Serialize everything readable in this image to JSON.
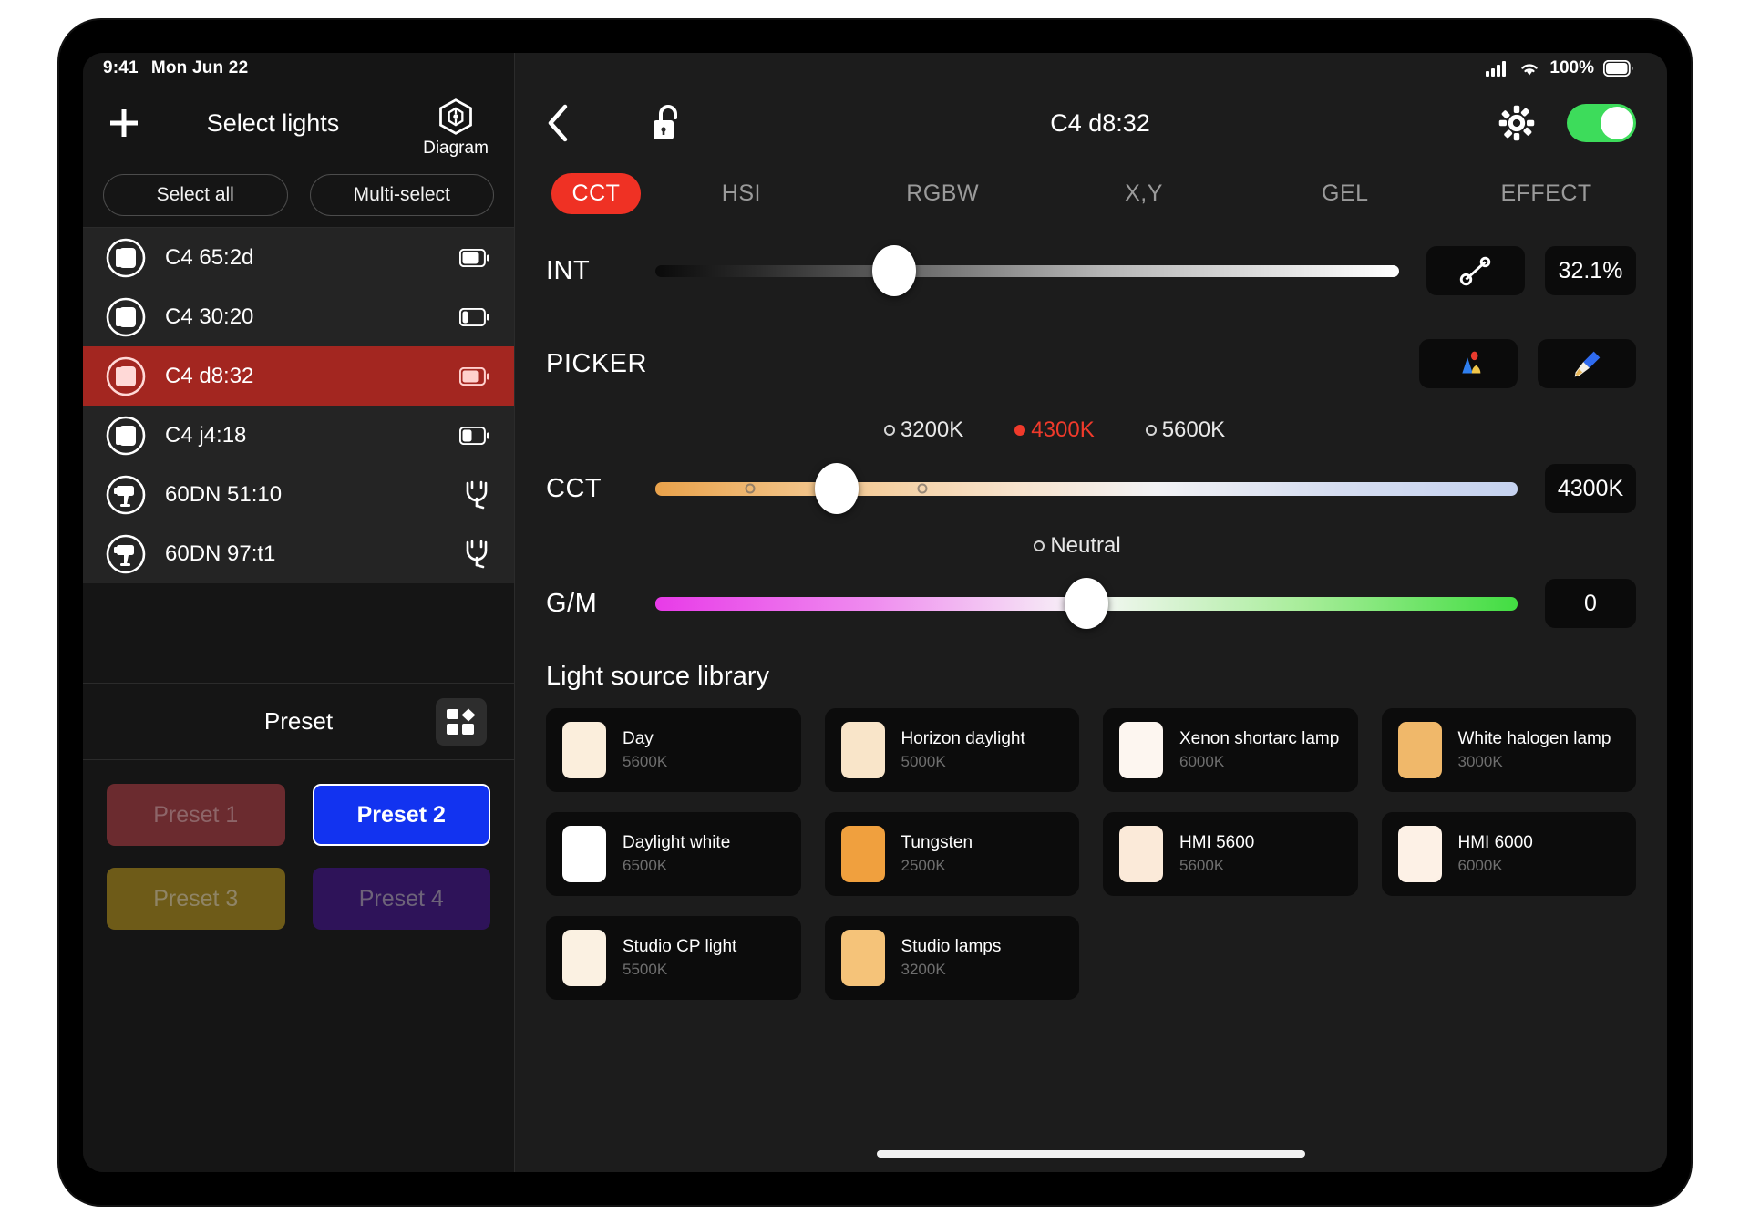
{
  "status_bar": {
    "time": "9:41",
    "date": "Mon Jun 22",
    "battery_percent": "100%",
    "cellular_icon": "signal-bars-icon",
    "wifi_icon": "wifi-icon",
    "battery_icon": "battery-full-icon"
  },
  "sidebar": {
    "add_icon": "plus-icon",
    "title": "Select lights",
    "diagram": {
      "label": "Diagram",
      "icon": "cube-diagram-icon"
    },
    "select_all_label": "Select all",
    "multi_select_label": "Multi-select",
    "lights": [
      {
        "name": "C4 65:2d",
        "icon": "panel-light-icon",
        "status_icon": "battery-high-icon",
        "selected": false
      },
      {
        "name": "C4 30:20",
        "icon": "panel-light-icon",
        "status_icon": "battery-low-icon",
        "selected": false
      },
      {
        "name": "C4 d8:32",
        "icon": "panel-light-icon",
        "status_icon": "battery-high-icon",
        "selected": true
      },
      {
        "name": "C4 j4:18",
        "icon": "panel-light-icon",
        "status_icon": "battery-mid-icon",
        "selected": false
      },
      {
        "name": "60DN 51:10",
        "icon": "spot-light-icon",
        "status_icon": "plug-icon",
        "selected": false
      },
      {
        "name": "60DN 97:t1",
        "icon": "spot-light-icon",
        "status_icon": "plug-icon",
        "selected": false
      }
    ],
    "preset_header": "Preset",
    "preset_grid_icon": "grid-layout-icon",
    "presets": [
      {
        "label": "Preset 1",
        "bg": "#6b2b2f",
        "text": "#8d6568",
        "active": false
      },
      {
        "label": "Preset 2",
        "bg": "#1233f0",
        "text": "#ffffff",
        "active": true
      },
      {
        "label": "Preset 3",
        "bg": "#6e5b18",
        "text": "#8f8466",
        "active": false
      },
      {
        "label": "Preset 4",
        "bg": "#2e1359",
        "text": "#6d6379",
        "active": false
      }
    ]
  },
  "main": {
    "back_icon": "chevron-left-icon",
    "lock_icon": "unlocked-padlock-icon",
    "title": "C4 d8:32",
    "gear_icon": "gear-icon",
    "power_toggle": {
      "state": "on",
      "color": "#3ddc5b"
    },
    "tabs": [
      {
        "label": "CCT",
        "active": true
      },
      {
        "label": "HSI",
        "active": false
      },
      {
        "label": "RGBW",
        "active": false
      },
      {
        "label": "X,Y",
        "active": false
      },
      {
        "label": "GEL",
        "active": false
      },
      {
        "label": "EFFECT",
        "active": false
      }
    ],
    "accent_color": "#ef3124",
    "intensity": {
      "label": "INT",
      "value": "32.1%",
      "percent": 32.1,
      "curve_icon": "intensity-curve-icon"
    },
    "picker": {
      "label": "PICKER",
      "palette_icon": "color-palette-icon",
      "eyedropper_icon": "eyedropper-icon"
    },
    "cct": {
      "label": "CCT",
      "value": "4300K",
      "percent": 21,
      "markers": [
        {
          "label": "3200K",
          "active": false,
          "percent": 11
        },
        {
          "label": "4300K",
          "active": true,
          "percent": 35
        },
        {
          "label": "5600K",
          "active": false,
          "percent": 62
        }
      ]
    },
    "gm": {
      "label": "G/M",
      "value": "0",
      "percent": 50,
      "marker": {
        "label": "Neutral",
        "active": false
      }
    },
    "library": {
      "title": "Light source library",
      "items": [
        {
          "name": "Day",
          "kelvin": "5600K",
          "swatch": "#fbeedc"
        },
        {
          "name": "Horizon daylight",
          "kelvin": "5000K",
          "swatch": "#f9e5c9"
        },
        {
          "name": "Xenon shortarc lamp",
          "kelvin": "6000K",
          "swatch": "#fdf6f0"
        },
        {
          "name": "White halogen lamp",
          "kelvin": "3000K",
          "swatch": "#f0b86a"
        },
        {
          "name": "Daylight white",
          "kelvin": "6500K",
          "swatch": "#ffffff"
        },
        {
          "name": "Tungsten",
          "kelvin": "2500K",
          "swatch": "#f0a03e"
        },
        {
          "name": "HMI 5600",
          "kelvin": "5600K",
          "swatch": "#fbead9"
        },
        {
          "name": "HMI 6000",
          "kelvin": "6000K",
          "swatch": "#fdf1e6"
        },
        {
          "name": "Studio CP light",
          "kelvin": "5500K",
          "swatch": "#fbf1e2"
        },
        {
          "name": "Studio lamps",
          "kelvin": "3200K",
          "swatch": "#f5c379"
        }
      ]
    }
  }
}
